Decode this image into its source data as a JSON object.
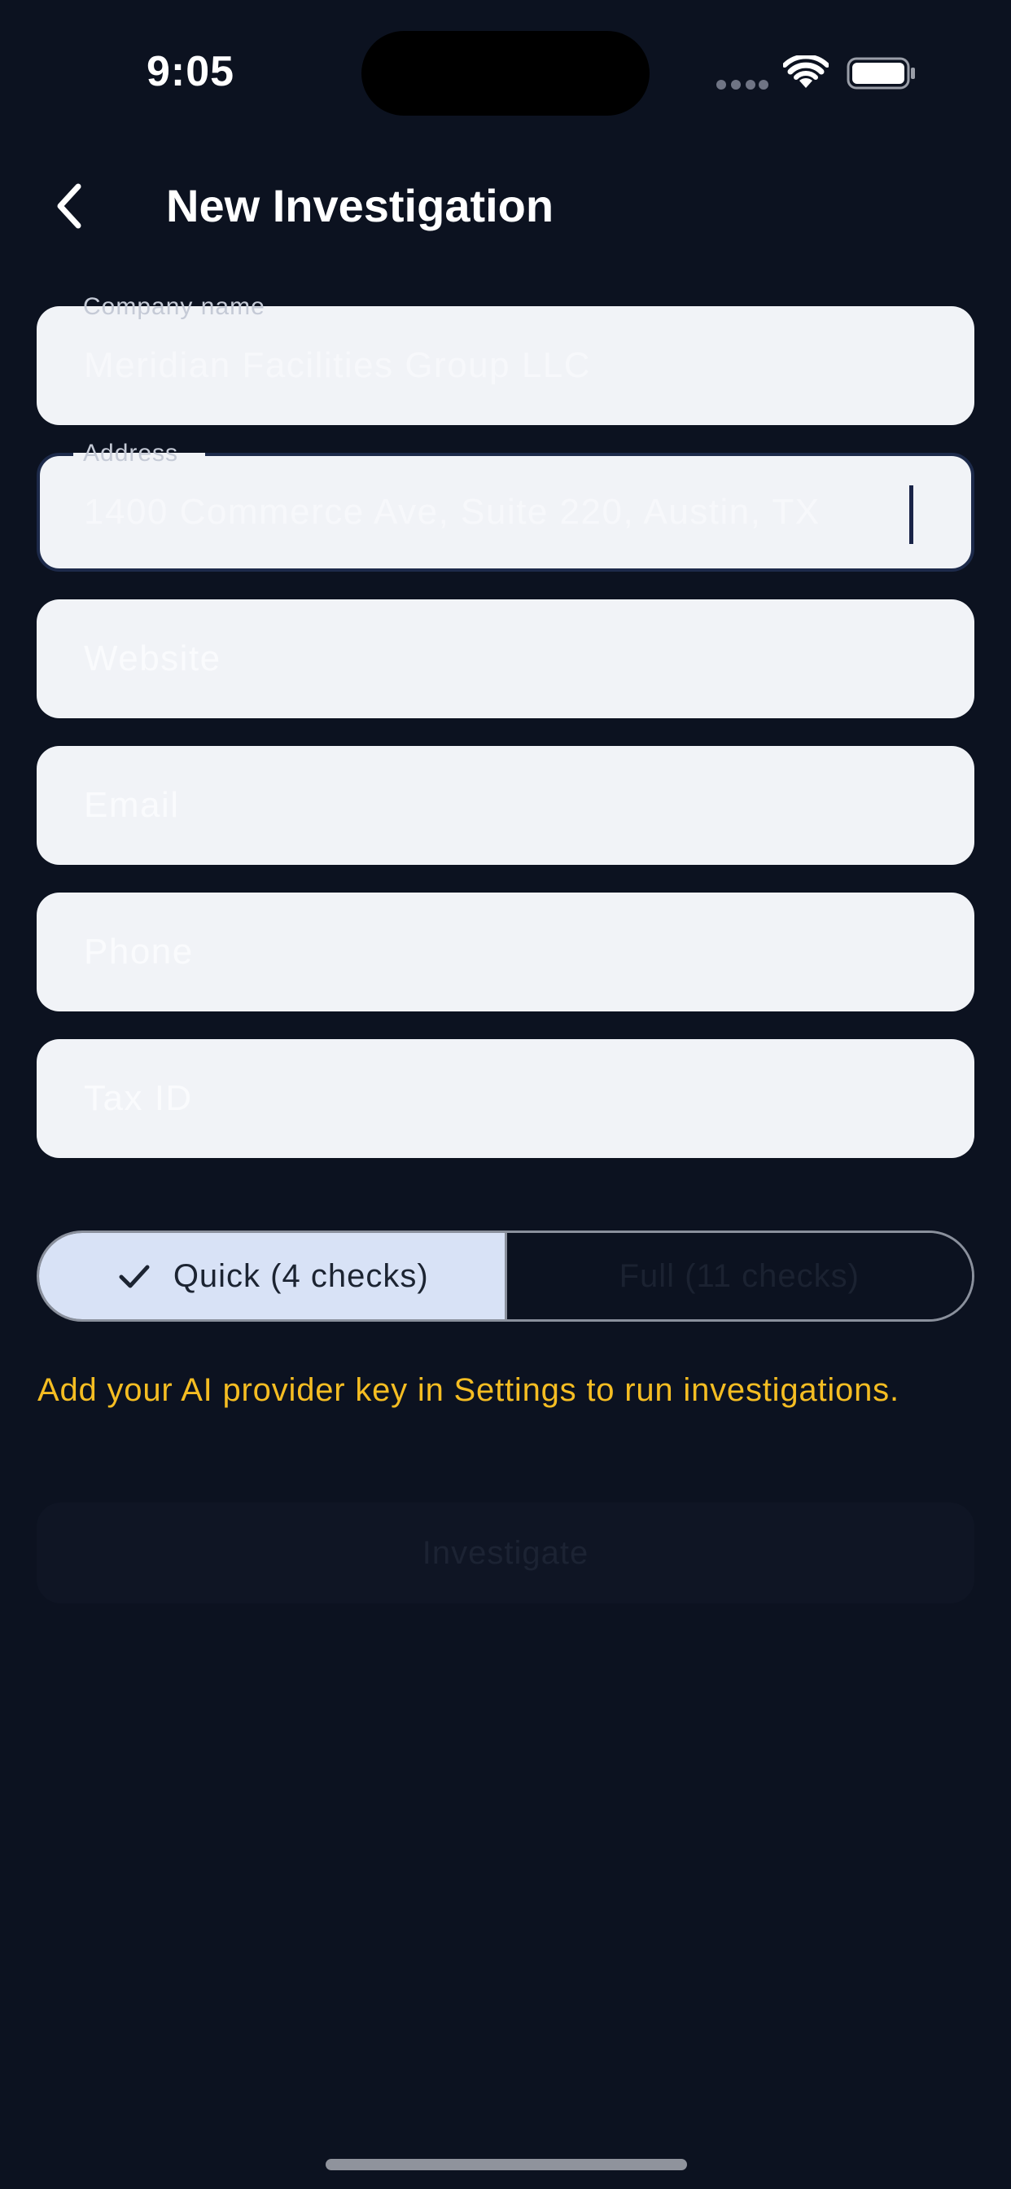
{
  "status_bar": {
    "time": "9:05",
    "icons": [
      "signal-dots-icon",
      "wifi-icon",
      "battery-icon"
    ]
  },
  "nav": {
    "back_icon": "chevron-left-icon",
    "title": "New Investigation"
  },
  "form": {
    "company_name": {
      "label": "Company name",
      "value": "Meridian Facilities Group LLC"
    },
    "address": {
      "label": "Address",
      "value": "1400 Commerce Ave, Suite 220, Austin, TX"
    },
    "website": {
      "placeholder": "Website"
    },
    "email": {
      "placeholder": "Email"
    },
    "phone": {
      "placeholder": "Phone"
    },
    "tax_id": {
      "placeholder": "Tax ID"
    }
  },
  "mode_selector": {
    "options": [
      {
        "label": "Quick (4 checks)",
        "selected": true
      },
      {
        "label": "Full (11 checks)",
        "selected": false
      }
    ]
  },
  "warning": "Add your AI provider key in Settings to run investigations.",
  "investigate_button": {
    "label": "Investigate",
    "enabled": false
  },
  "colors": {
    "background": "#0c1220",
    "field_fill": "#f1f3f7",
    "selected_segment": "#d8e2f6",
    "warning": "#f5bd22"
  }
}
